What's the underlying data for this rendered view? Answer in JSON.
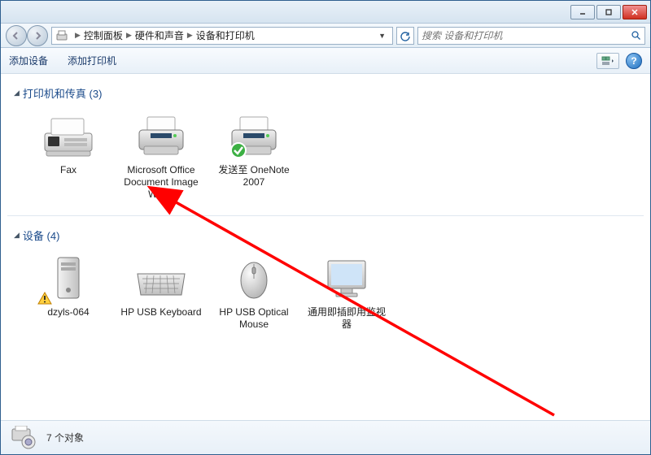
{
  "titlebar": {},
  "breadcrumb": {
    "seg1": "控制面板",
    "seg2": "硬件和声音",
    "seg3": "设备和打印机"
  },
  "search": {
    "placeholder": "搜索 设备和打印机"
  },
  "toolbar": {
    "add_device": "添加设备",
    "add_printer": "添加打印机"
  },
  "groups": {
    "printers": {
      "title": "打印机和传真 (3)"
    },
    "devices": {
      "title": "设备 (4)"
    }
  },
  "items": {
    "fax": "Fax",
    "msoffice": "Microsoft Office Document Image Writer",
    "onenote": "发送至 OneNote 2007",
    "pc": "dzyls-064",
    "kbd": "HP USB Keyboard",
    "mouse": "HP USB Optical Mouse",
    "monitor": "通用即插即用监视器"
  },
  "status": {
    "count": "7 个对象"
  }
}
